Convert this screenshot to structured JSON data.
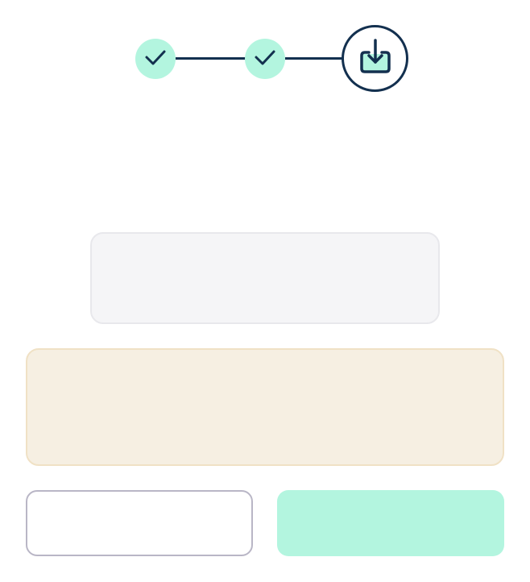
{
  "stepper": {
    "steps": [
      {
        "status": "completed",
        "icon": "check-icon"
      },
      {
        "status": "completed",
        "icon": "check-icon"
      },
      {
        "status": "current",
        "icon": "download-tray-icon"
      }
    ],
    "colors": {
      "completed_fill": "#b3f5df",
      "line_and_icon": "#13304f"
    }
  },
  "info_box": {
    "text": ""
  },
  "notice_box": {
    "text": ""
  },
  "actions": {
    "secondary_label": "",
    "primary_label": ""
  },
  "colors": {
    "accent": "#b3f5df",
    "notice_bg": "#f6efe2",
    "info_bg": "#f5f5f7"
  }
}
